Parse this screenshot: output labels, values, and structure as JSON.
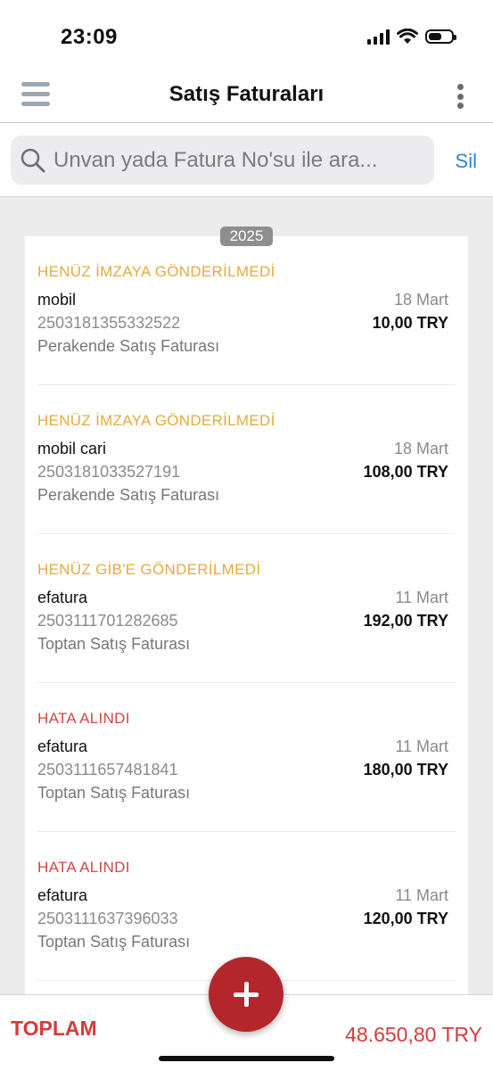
{
  "status_bar": {
    "time": "23:09"
  },
  "nav": {
    "title": "Satış Faturaları"
  },
  "search": {
    "placeholder": "Unvan yada Fatura No'su ile ara...",
    "clear_label": "Sil"
  },
  "year_badge": "2025",
  "invoices": [
    {
      "status": "HENÜZ İMZAYA GÖNDERİLMEDİ",
      "status_type": "warning",
      "name": "mobil",
      "number": "2503181355332522",
      "type": "Perakende Satış Faturası",
      "date": "18 Mart",
      "amount": "10,00 TRY"
    },
    {
      "status": "HENÜZ İMZAYA GÖNDERİLMEDİ",
      "status_type": "warning",
      "name": "mobil cari",
      "number": "2503181033527191",
      "type": "Perakende Satış Faturası",
      "date": "18 Mart",
      "amount": "108,00 TRY"
    },
    {
      "status": "HENÜZ GİB'E GÖNDERİLMEDİ",
      "status_type": "warning",
      "name": "efatura",
      "number": "2503111701282685",
      "type": "Toptan Satış Faturası",
      "date": "11 Mart",
      "amount": "192,00 TRY"
    },
    {
      "status": "HATA ALINDI",
      "status_type": "error",
      "name": "efatura",
      "number": "2503111657481841",
      "type": "Toptan Satış Faturası",
      "date": "11 Mart",
      "amount": "180,00 TRY"
    },
    {
      "status": "HATA ALINDI",
      "status_type": "error",
      "name": "efatura",
      "number": "2503111637396033",
      "type": "Toptan Satış Faturası",
      "date": "11 Mart",
      "amount": "120,00 TRY"
    }
  ],
  "footer": {
    "total_label": "TOPLAM",
    "total_amount": "48.650,80 TRY"
  },
  "colors": {
    "warning": "#e8a93c",
    "error": "#d64545",
    "accent": "#b3262c",
    "link": "#2f84d6"
  }
}
